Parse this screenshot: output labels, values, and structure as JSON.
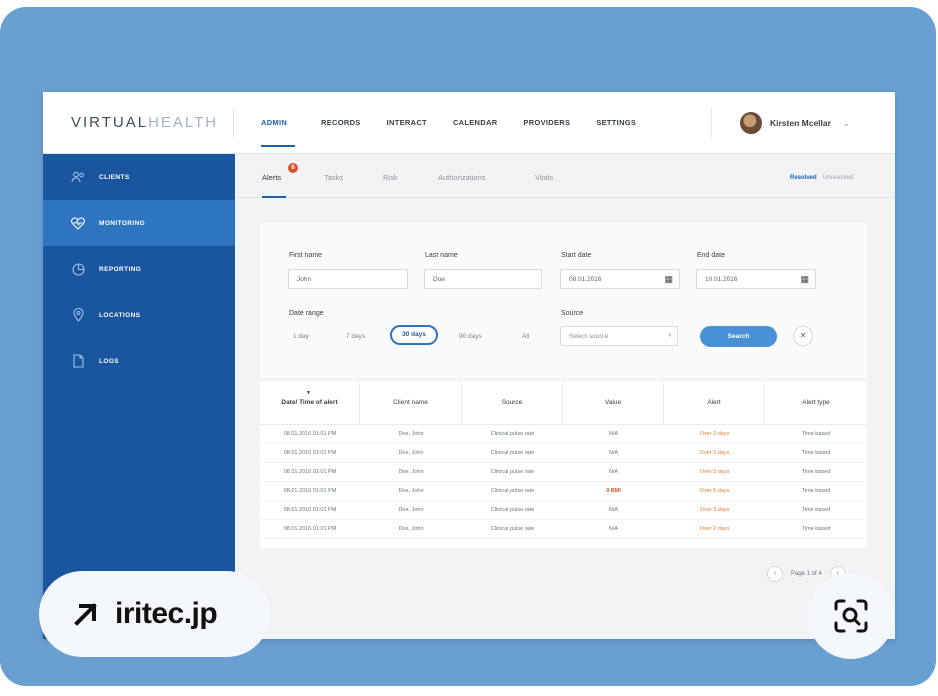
{
  "app": {
    "logo_bold": "VIRTUAL",
    "logo_light": "HEALTH",
    "nav": [
      "ADMIN",
      "RECORDS",
      "INTERACT",
      "CALENDAR",
      "PROVIDERS",
      "SETTINGS"
    ],
    "user_name": "Kirsten Mcellar"
  },
  "sidebar": {
    "items": [
      {
        "label": "CLIENTS",
        "icon": "people-icon"
      },
      {
        "label": "MONITORING",
        "icon": "heart-pulse-icon"
      },
      {
        "label": "REPORTING",
        "icon": "pie-chart-icon"
      },
      {
        "label": "LOCATIONS",
        "icon": "map-pin-icon"
      },
      {
        "label": "LOGS",
        "icon": "document-icon"
      }
    ]
  },
  "tabs": {
    "items": [
      "Alerts",
      "Tasks",
      "Risk",
      "Authorizations",
      "Vitals"
    ],
    "badge": "6",
    "resolved": "Resolved",
    "unresolved": "Unresolved"
  },
  "form": {
    "first_name_label": "First name",
    "first_name_value": "John",
    "last_name_label": "Last name",
    "last_name_value": "Doe",
    "start_date_label": "Start date",
    "start_date_value": "08.01.2016",
    "end_date_label": "End date",
    "end_date_value": "10.01.2016",
    "date_range_label": "Date range",
    "date_ranges": [
      "1 day",
      "7 days",
      "30 days",
      "90 days",
      "All"
    ],
    "source_label": "Source",
    "source_placeholder": "Select source",
    "search_label": "Search",
    "clear_label": "✕"
  },
  "table": {
    "headers": [
      "Date/ Time of alert",
      "Client name",
      "Source",
      "Value",
      "Alert",
      "Alert type"
    ],
    "rows": [
      [
        "08.01.2016 01:01 PM",
        "Doe, John",
        "Clinical pulse rate",
        "N/A",
        "Over 2 days",
        "Time based"
      ],
      [
        "08.01.2016 01:01 PM",
        "Doe, John",
        "Clinical pulse rate",
        "N/A",
        "Over 2 days",
        "Time based"
      ],
      [
        "08.01.2016 01:01 PM",
        "Doe, John",
        "Clinical pulse rate",
        "N/A",
        "Over 5 days",
        "Time based"
      ],
      [
        "08.01.2016 01:01 PM",
        "Doe, John",
        "Clinical pulse rate",
        "9 BMI",
        "Over 5 days",
        "Time based"
      ],
      [
        "08.01.2016 01:01 PM",
        "Doe, John",
        "Clinical pulse rate",
        "N/A",
        "Over 3 days",
        "Time based"
      ],
      [
        "08.01.2016 01:01 PM",
        "Doe, John",
        "Clinical pulse rate",
        "N/A",
        "Over 2 days",
        "Time based"
      ]
    ]
  },
  "pager": {
    "text": "Page 1 of 4"
  },
  "overlay": {
    "source_link": "iritec.jp"
  },
  "colors": {
    "background": "#6a9fd2",
    "sidebar": "#1a55a0",
    "sidebar_active": "#2f74c0",
    "accent": "#1f5fa8",
    "alert": "#e07a3a"
  }
}
